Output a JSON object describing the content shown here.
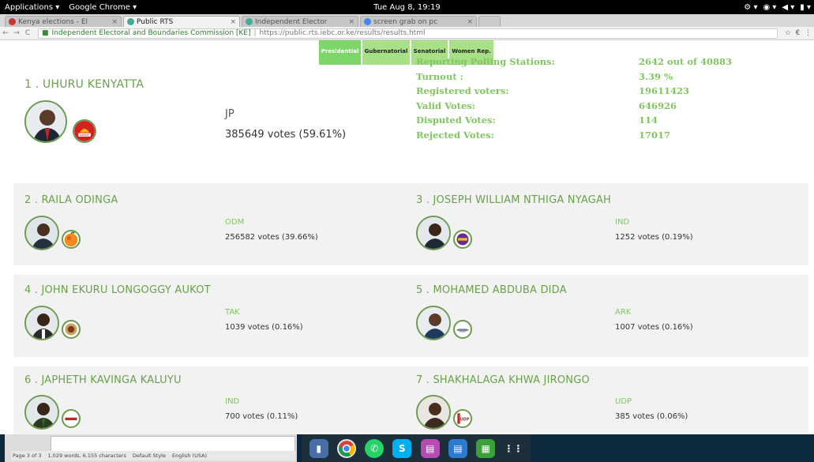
{
  "system": {
    "applications": "Applications ▾",
    "chrome_menu": "Google Chrome ▾",
    "clock": "Tue Aug 8, 19:19",
    "tray": [
      "⚙ ▾",
      "◉ ▾",
      "◀ ▾",
      "▮ ▾"
    ]
  },
  "browser": {
    "tabs": [
      {
        "label": "Kenya elections - El",
        "active": false
      },
      {
        "label": "Public RTS",
        "active": true
      },
      {
        "label": "Independent Elector",
        "active": false
      },
      {
        "label": "screen grab on pc",
        "active": false
      }
    ],
    "site_name": "Independent Electoral and Boundaries Commission [KE]",
    "url": "https://public.rts.iebc.or.ke/results/results.html"
  },
  "category_tabs": [
    {
      "label": "Presidential",
      "active": true
    },
    {
      "label": "Gubernatorial",
      "active": false
    },
    {
      "label": "Senatorial",
      "active": false
    },
    {
      "label": "Women Rep.",
      "active": false
    }
  ],
  "leader": {
    "name": "1 . UHURU KENYATTA",
    "party": "JP",
    "votes": "385649 votes (59.61%)",
    "logo_text": "Jubilee"
  },
  "stats": [
    {
      "label": "Reporting Polling Stations:",
      "value": "2642 out of 40883"
    },
    {
      "label": "Turnout :",
      "value": "3.39 %"
    },
    {
      "label": "Registered voters:",
      "value": "19611423"
    },
    {
      "label": "Valid Votes:",
      "value": "646926"
    },
    {
      "label": "Disputed Votes:",
      "value": "114"
    },
    {
      "label": "Rejected Votes:",
      "value": "17017"
    }
  ],
  "candidates": [
    {
      "name": "2 . RAILA ODINGA",
      "party": "ODM",
      "votes": "256582 votes (39.66%)"
    },
    {
      "name": "3 . JOSEPH WILLIAM NTHIGA NYAGAH",
      "party": "IND",
      "votes": "1252 votes (0.19%)"
    },
    {
      "name": "4 . JOHN EKURU LONGOGGY AUKOT",
      "party": "TAK",
      "votes": "1039 votes (0.16%)"
    },
    {
      "name": "5 . MOHAMED ABDUBA DIDA",
      "party": "ARK",
      "votes": "1007 votes (0.16%)"
    },
    {
      "name": "6 . JAPHETH KAVINGA KALUYU",
      "party": "IND",
      "votes": "700 votes (0.11%)"
    },
    {
      "name": "7 . SHAKHALAGA KHWA JIRONGO",
      "party": "UDP",
      "votes": "385 votes (0.06%)"
    }
  ],
  "logos": {
    "udp": "UDP"
  },
  "statusbar": [
    "Page 3 of 3",
    "1,029 words, 6,155 characters",
    "Default Style",
    "English (USA)"
  ],
  "colors": {
    "accent": "#7fc65e",
    "name": "#69a14a",
    "border": "#6c9a4e"
  }
}
